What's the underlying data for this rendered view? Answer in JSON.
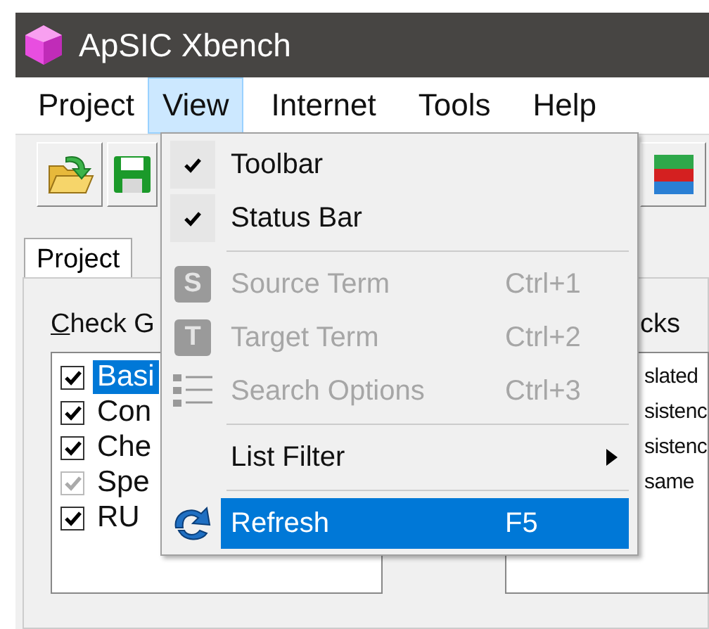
{
  "window": {
    "title": "ApSIC Xbench"
  },
  "menu_bar": [
    {
      "label": "Project",
      "selected": false
    },
    {
      "label": "View",
      "selected": true
    },
    {
      "label": "Internet",
      "selected": false
    },
    {
      "label": "Tools",
      "selected": false
    },
    {
      "label": "Help",
      "selected": false
    }
  ],
  "tabs": [
    {
      "label": "Project",
      "selected": true
    }
  ],
  "panel": {
    "left_heading": "Check G",
    "left_list": [
      {
        "label": "Basi",
        "checked": true,
        "disabled": false,
        "selected": true
      },
      {
        "label": "Con",
        "checked": true,
        "disabled": false,
        "selected": false
      },
      {
        "label": "Che",
        "checked": true,
        "disabled": false,
        "selected": false
      },
      {
        "label": "Spe",
        "checked": true,
        "disabled": true,
        "selected": false
      },
      {
        "label": "RU",
        "checked": true,
        "disabled": false,
        "selected": false
      }
    ],
    "right_heading": "cks",
    "right_list": [
      "slated",
      "sistenc",
      "sistenc",
      "same"
    ]
  },
  "view_menu": [
    {
      "kind": "check",
      "label": "Toolbar",
      "checked": true,
      "disabled": false,
      "selected": false
    },
    {
      "kind": "check",
      "label": "Status Bar",
      "checked": true,
      "disabled": false,
      "selected": false
    },
    {
      "kind": "separator"
    },
    {
      "kind": "letter",
      "icon_letter": "S",
      "label": "Source Term",
      "shortcut": "Ctrl+1",
      "disabled": true,
      "selected": false
    },
    {
      "kind": "letter",
      "icon_letter": "T",
      "label": "Target Term",
      "shortcut": "Ctrl+2",
      "disabled": true,
      "selected": false
    },
    {
      "kind": "list",
      "label": "Search Options",
      "shortcut": "Ctrl+3",
      "disabled": true,
      "selected": false
    },
    {
      "kind": "separator"
    },
    {
      "kind": "submenu",
      "label": "List Filter",
      "disabled": false,
      "selected": false
    },
    {
      "kind": "separator"
    },
    {
      "kind": "action",
      "label": "Refresh",
      "shortcut": "F5",
      "disabled": false,
      "selected": true
    }
  ]
}
